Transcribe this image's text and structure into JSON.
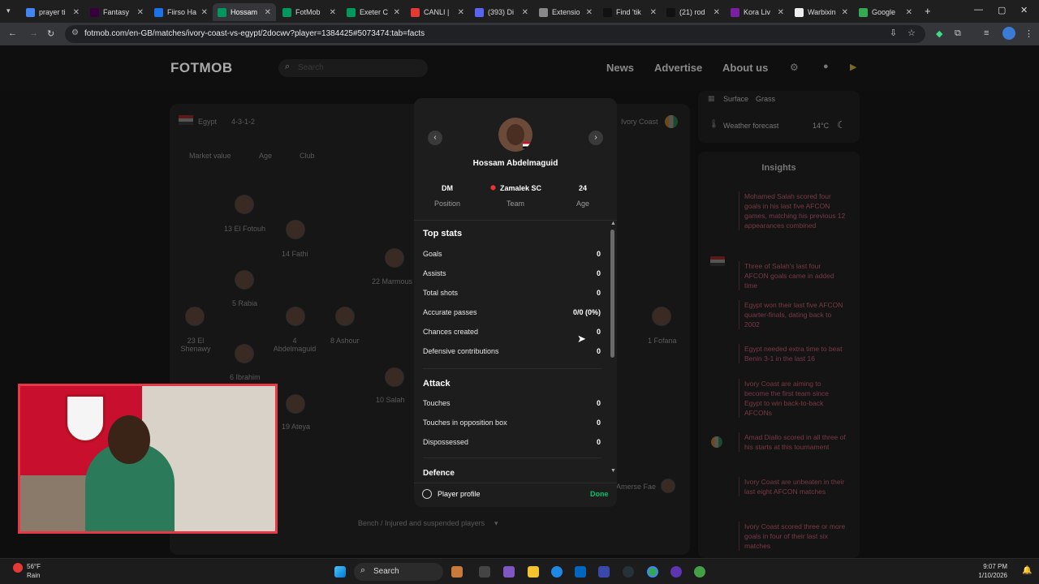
{
  "browser": {
    "tabs": [
      {
        "label": "prayer ti",
        "color": "#4285f4"
      },
      {
        "label": "Fantasy",
        "color": "#37003c"
      },
      {
        "label": "Fiirso Ha",
        "color": "#1a73e8"
      },
      {
        "label": "Hossam",
        "color": "#00985f",
        "active": true
      },
      {
        "label": "FotMob",
        "color": "#00985f"
      },
      {
        "label": "Exeter C",
        "color": "#00985f"
      },
      {
        "label": "CANLI |",
        "color": "#e53935"
      },
      {
        "label": "(393) Di",
        "color": "#5865f2"
      },
      {
        "label": "Extensio",
        "color": "#888888"
      },
      {
        "label": "Find 'tik",
        "color": "#111111"
      },
      {
        "label": "(21) rod",
        "color": "#111111"
      },
      {
        "label": "Kora Liv",
        "color": "#7b1fa2"
      },
      {
        "label": "Warbixin",
        "color": "#eeeeee"
      },
      {
        "label": "Google",
        "color": "#34a853"
      }
    ],
    "url": "fotmob.com/en-GB/matches/ivory-coast-vs-egypt/2docwv?player=1384425#5073474:tab=facts"
  },
  "header": {
    "logo": "FOTMOB",
    "search_placeholder": "Search",
    "nav": [
      "News",
      "Advertise",
      "About us"
    ]
  },
  "lineup": {
    "home_team": "Egypt",
    "formation": "4-3-1-2",
    "away_team": "Ivory Coast",
    "columns": [
      "Market value",
      "Age",
      "Club"
    ],
    "players": [
      {
        "label": "13 El Fotouh"
      },
      {
        "label": "14 Fathi"
      },
      {
        "label": "22 Marmous"
      },
      {
        "label": "5 Rabia"
      },
      {
        "label": "23 El Shenawy"
      },
      {
        "label": "4 Abdelmaguid"
      },
      {
        "label": "8 Ashour"
      },
      {
        "label": "6 Ibrahim"
      },
      {
        "label": "10 Salah"
      },
      {
        "label": "19 Ateya"
      },
      {
        "label": "1 Fofana"
      },
      {
        "label": "Amerse Fae"
      }
    ],
    "bench_label": "Bench / Injured and suspended players"
  },
  "match_info": {
    "surface_label": "Surface",
    "surface_value": "Grass",
    "weather_label": "Weather forecast",
    "weather_value": "14°C"
  },
  "insights": {
    "title": "Insights",
    "items": [
      "Mohamed Salah scored four goals in his last five AFCON games, matching his previous 12 appearances combined",
      "Three of Salah's last four AFCON goals came in added time",
      "Egypt won their last five AFCON quarter-finals, dating back to 2002",
      "Egypt needed extra time to beat Benin 3-1 in the last 16",
      "Ivory Coast are aiming to become the first team since Egypt to win back-to-back AFCONs",
      "Amad Diallo scored in all three of his starts at this tournament",
      "Ivory Coast are unbeaten in their last eight AFCON matches",
      "Ivory Coast scored three or more goals in four of their last six matches"
    ]
  },
  "player_modal": {
    "name": "Hossam Abdelmaguid",
    "position_value": "DM",
    "position_label": "Position",
    "team_value": "Zamalek SC",
    "team_label": "Team",
    "age_value": "24",
    "age_label": "Age",
    "sections": [
      {
        "title": "Top stats",
        "stats": [
          {
            "label": "Goals",
            "value": "0"
          },
          {
            "label": "Assists",
            "value": "0"
          },
          {
            "label": "Total shots",
            "value": "0"
          },
          {
            "label": "Accurate passes",
            "value": "0/0 (0%)"
          },
          {
            "label": "Chances created",
            "value": "0"
          },
          {
            "label": "Defensive contributions",
            "value": "0"
          }
        ]
      },
      {
        "title": "Attack",
        "stats": [
          {
            "label": "Touches",
            "value": "0"
          },
          {
            "label": "Touches in opposition box",
            "value": "0"
          },
          {
            "label": "Dispossessed",
            "value": "0"
          }
        ]
      },
      {
        "title": "Defence",
        "stats": []
      }
    ],
    "profile_label": "Player profile",
    "done_label": "Done"
  },
  "taskbar": {
    "weather_temp": "56°F",
    "weather_desc": "Rain",
    "search_label": "Search",
    "time": "9:07 PM",
    "date": "1/10/2026"
  }
}
